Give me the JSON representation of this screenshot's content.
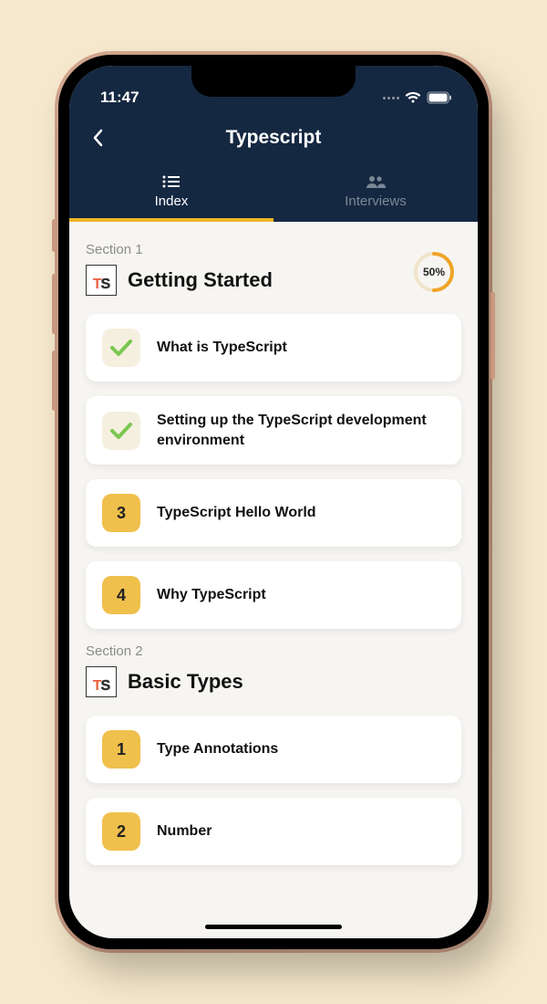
{
  "status": {
    "time": "11:47"
  },
  "header": {
    "title": "Typescript"
  },
  "tabs": {
    "index_label": "Index",
    "interviews_label": "Interviews"
  },
  "sections": [
    {
      "label": "Section 1",
      "title": "Getting Started",
      "progress_pct": "50%",
      "items": [
        {
          "done": true,
          "num": "",
          "title": "What is TypeScript"
        },
        {
          "done": true,
          "num": "",
          "title": "Setting up the TypeScript development environment"
        },
        {
          "done": false,
          "num": "3",
          "title": "TypeScript Hello World"
        },
        {
          "done": false,
          "num": "4",
          "title": "Why TypeScript"
        }
      ]
    },
    {
      "label": "Section 2",
      "title": "Basic Types",
      "items": [
        {
          "done": false,
          "num": "1",
          "title": "Type Annotations"
        },
        {
          "done": false,
          "num": "2",
          "title": "Number"
        }
      ]
    }
  ]
}
